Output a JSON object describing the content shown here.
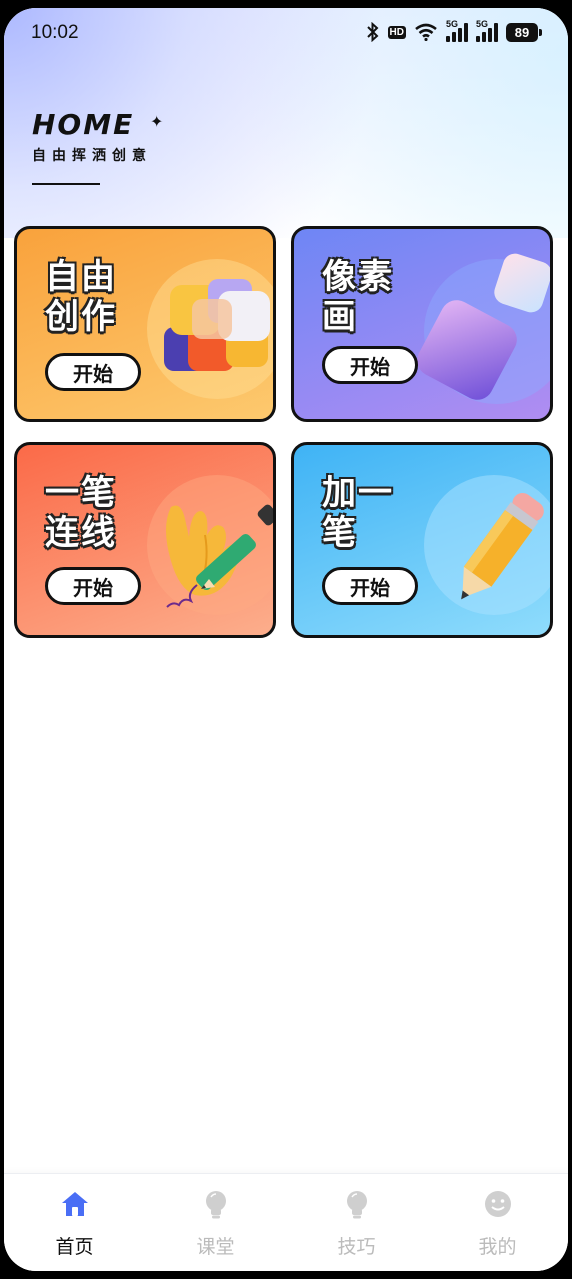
{
  "status_bar": {
    "time": "10:02",
    "hd_label": "HD",
    "network_1": "5G",
    "network_2": "5G",
    "battery": "89"
  },
  "brand": {
    "title": "HOME",
    "subtitle": "自由挥洒创意"
  },
  "cards": [
    {
      "title_line1": "自由",
      "title_line2": "创作",
      "button": "开始",
      "color": "#f9a23c"
    },
    {
      "title_line1": "像素",
      "title_line2": "画",
      "button": "开始",
      "color": "#6e86f5"
    },
    {
      "title_line1": "一笔",
      "title_line2": "连线",
      "button": "开始",
      "color": "#fb6a48"
    },
    {
      "title_line1": "加一",
      "title_line2": "笔",
      "button": "开始",
      "color": "#3fb3f5"
    }
  ],
  "tabbar": {
    "active_color": "#4a6ef5",
    "inactive_color": "#c8c8c8",
    "tabs": [
      {
        "label": "首页",
        "icon": "home-icon",
        "active": true
      },
      {
        "label": "课堂",
        "icon": "lightbulb-icon",
        "active": false
      },
      {
        "label": "技巧",
        "icon": "lightbulb-icon",
        "active": false
      },
      {
        "label": "我的",
        "icon": "smiley-icon",
        "active": false
      }
    ]
  }
}
